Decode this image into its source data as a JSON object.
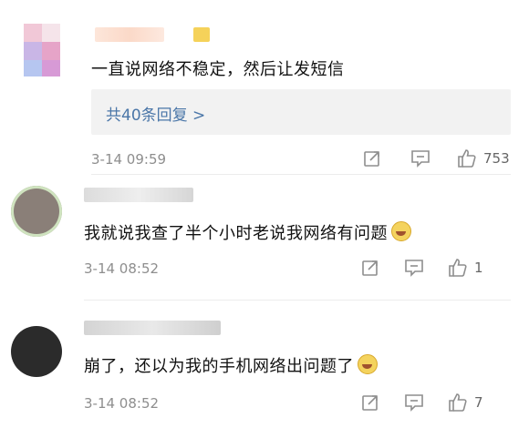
{
  "comments": [
    {
      "text": "一直说网络不稳定，然后让发短信",
      "reply_link": "共40条回复 >",
      "timestamp": "3-14 09:59",
      "like_count": "753"
    },
    {
      "text": "我就说我查了半个小时老说我网络有问题",
      "timestamp": "3-14 08:52",
      "like_count": "1"
    },
    {
      "text": "崩了，还以为我的手机网络出问题了",
      "timestamp": "3-14 08:52",
      "like_count": "7"
    }
  ],
  "icons": [
    "share-icon",
    "comment-icon",
    "like-icon",
    "laugh-cry-emoji-icon"
  ],
  "colors": {
    "reply_link": "#4a76a8",
    "meta_text": "#8e8e8e",
    "reply_box_bg": "#f2f2f2"
  }
}
